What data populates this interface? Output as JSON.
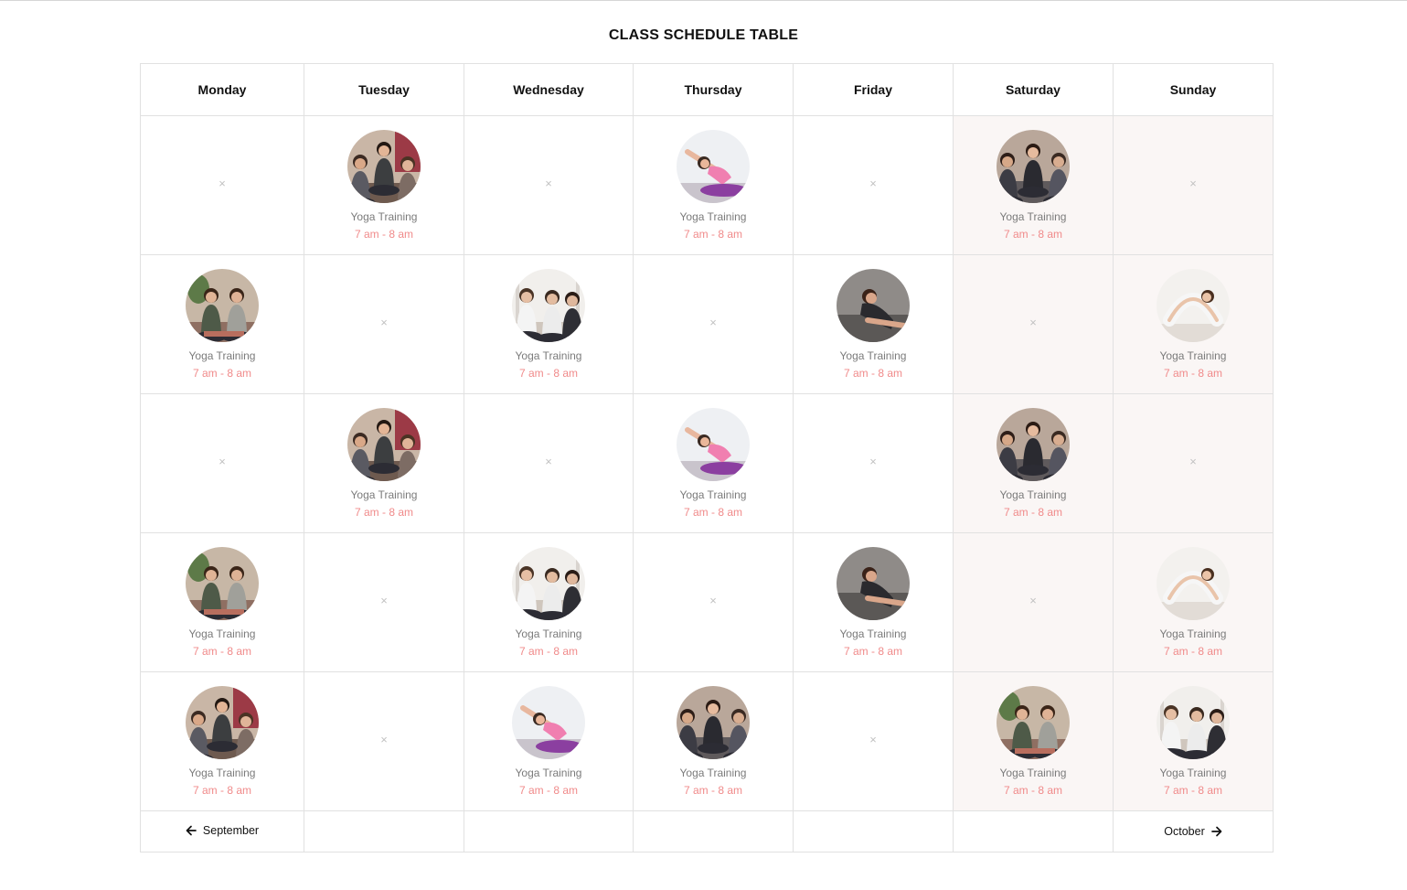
{
  "title": "CLASS SCHEDULE TABLE",
  "days": [
    "Monday",
    "Tuesday",
    "Wednesday",
    "Thursday",
    "Friday",
    "Saturday",
    "Sunday"
  ],
  "empty_glyph": "×",
  "colors": {
    "time_text": "#f08a8a",
    "weekend_bg": "#faf6f5",
    "border": "#e1e1e1"
  },
  "rows": [
    [
      null,
      {
        "name": "Yoga Training",
        "time": "7 am - 8 am",
        "photo": "yoga-photo-woman-seated-studio"
      },
      null,
      {
        "name": "Yoga Training",
        "time": "7 am - 8 am",
        "photo": "yoga-photo-side-stretch-pink"
      },
      null,
      {
        "name": "Yoga Training",
        "time": "7 am - 8 am",
        "photo": "yoga-photo-meditation-group"
      },
      null
    ],
    [
      {
        "name": "Yoga Training",
        "time": "7 am - 8 am",
        "photo": "yoga-photo-two-women-plants"
      },
      null,
      {
        "name": "Yoga Training",
        "time": "7 am - 8 am",
        "photo": "yoga-photo-class-seated-white"
      },
      null,
      {
        "name": "Yoga Training",
        "time": "7 am - 8 am",
        "photo": "yoga-photo-forward-bend-dark"
      },
      null,
      {
        "name": "Yoga Training",
        "time": "7 am - 8 am",
        "photo": "yoga-photo-backbend-white"
      }
    ],
    [
      null,
      {
        "name": "Yoga Training",
        "time": "7 am - 8 am",
        "photo": "yoga-photo-woman-seated-studio"
      },
      null,
      {
        "name": "Yoga Training",
        "time": "7 am - 8 am",
        "photo": "yoga-photo-side-stretch-pink"
      },
      null,
      {
        "name": "Yoga Training",
        "time": "7 am - 8 am",
        "photo": "yoga-photo-meditation-group"
      },
      null
    ],
    [
      {
        "name": "Yoga Training",
        "time": "7 am - 8 am",
        "photo": "yoga-photo-two-women-plants"
      },
      null,
      {
        "name": "Yoga Training",
        "time": "7 am - 8 am",
        "photo": "yoga-photo-class-seated-white"
      },
      null,
      {
        "name": "Yoga Training",
        "time": "7 am - 8 am",
        "photo": "yoga-photo-forward-bend-dark"
      },
      null,
      {
        "name": "Yoga Training",
        "time": "7 am - 8 am",
        "photo": "yoga-photo-backbend-white"
      }
    ],
    [
      {
        "name": "Yoga Training",
        "time": "7 am - 8 am",
        "photo": "yoga-photo-woman-seated-studio"
      },
      null,
      {
        "name": "Yoga Training",
        "time": "7 am - 8 am",
        "photo": "yoga-photo-side-stretch-pink"
      },
      {
        "name": "Yoga Training",
        "time": "7 am - 8 am",
        "photo": "yoga-photo-meditation-group"
      },
      null,
      {
        "name": "Yoga Training",
        "time": "7 am - 8 am",
        "photo": "yoga-photo-two-women-plants"
      },
      {
        "name": "Yoga Training",
        "time": "7 am - 8 am",
        "photo": "yoga-photo-class-seated-white"
      }
    ]
  ],
  "nav": {
    "prev_label": "September",
    "prev_icon": "arrow-left-icon",
    "next_label": "October",
    "next_icon": "arrow-right-icon"
  }
}
